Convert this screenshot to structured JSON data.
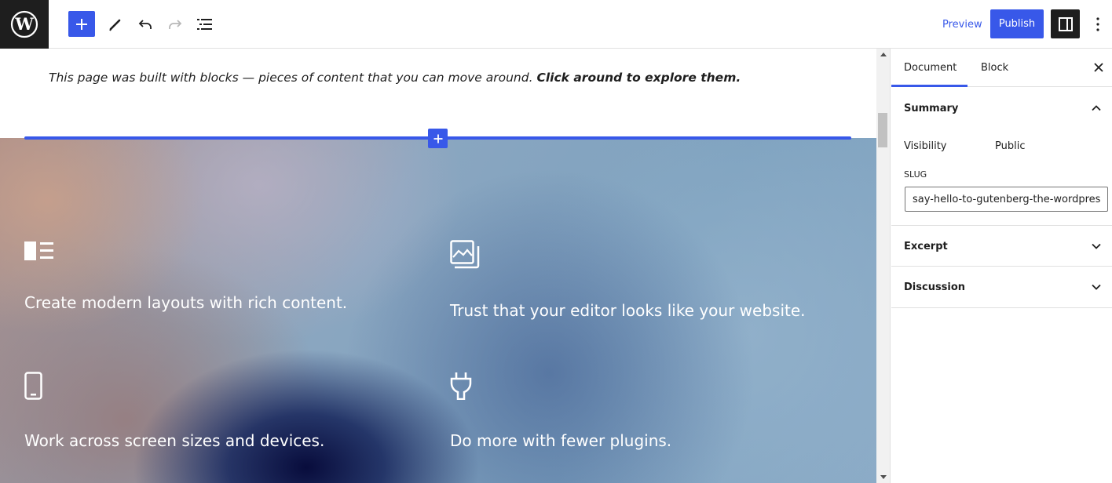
{
  "toolbar": {
    "add_block_label": "Add block",
    "preview_label": "Preview",
    "publish_label": "Publish"
  },
  "content": {
    "intro_text": "This page was built with blocks — pieces of content that you can move around.",
    "intro_bold": "Click around to explore them.",
    "features": [
      {
        "icon": "layout-icon",
        "text": "Create modern layouts with rich content."
      },
      {
        "icon": "gallery-icon",
        "text": "Trust that your editor looks like your website."
      },
      {
        "icon": "mobile-icon",
        "text": "Work across screen sizes and devices."
      },
      {
        "icon": "plug-icon",
        "text": "Do more with fewer plugins."
      }
    ]
  },
  "sidebar": {
    "tabs": [
      {
        "label": "Document",
        "active": true
      },
      {
        "label": "Block",
        "active": false
      }
    ],
    "summary": {
      "title": "Summary",
      "visibility_label": "Visibility",
      "visibility_value": "Public",
      "slug_label": "SLUG",
      "slug_value": "say-hello-to-gutenberg-the-wordpress-editor"
    },
    "excerpt_title": "Excerpt",
    "discussion_title": "Discussion"
  },
  "colors": {
    "accent": "#3858e9",
    "dark": "#1e1e1e"
  }
}
